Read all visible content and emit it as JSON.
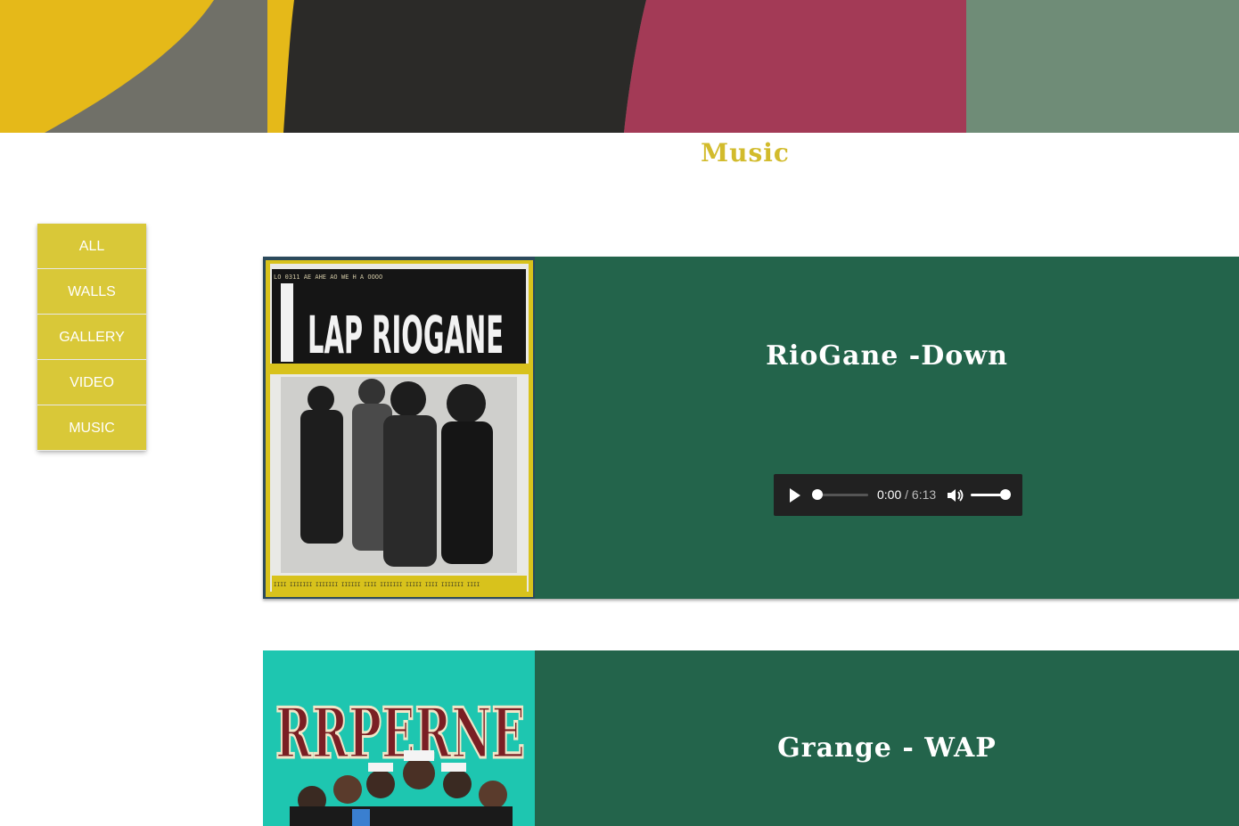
{
  "header": {
    "title": "Music",
    "accent_color": "#d2bb2c"
  },
  "sidebar": {
    "items": [
      {
        "label": "ALL"
      },
      {
        "label": "WALLS"
      },
      {
        "label": "GALLERY"
      },
      {
        "label": "VIDEO"
      },
      {
        "label": "MUSIC"
      }
    ],
    "button_color": "#d9c838"
  },
  "tracks": [
    {
      "title": "RioGane -Down",
      "cover_text": "LAP RIOGANE",
      "player": {
        "current_time": "0:00",
        "duration": "6:13",
        "separator": "/",
        "progress": 0,
        "volume": 1
      }
    },
    {
      "title": "Grange - WAP",
      "cover_text": "RRPERNE"
    }
  ],
  "colors": {
    "card_background": "#23644b",
    "banner": [
      "#e5b919",
      "#707068",
      "#2b2a28",
      "#a33a56",
      "#6f8c77"
    ]
  }
}
